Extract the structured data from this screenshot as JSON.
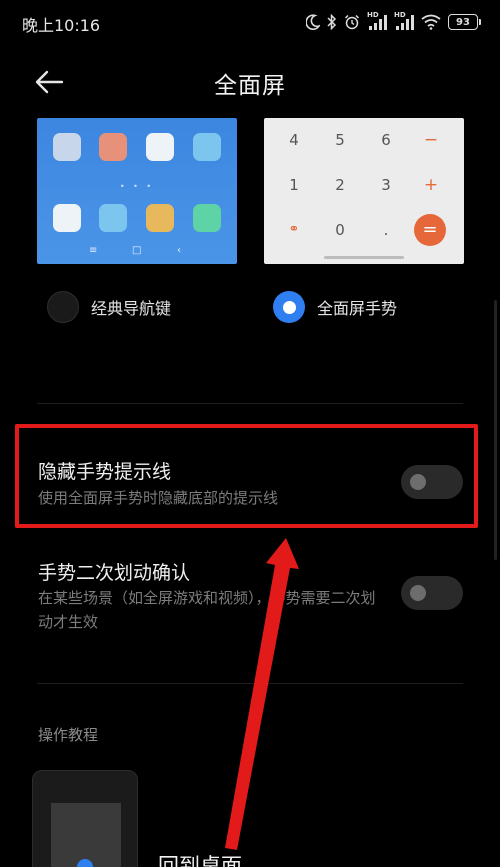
{
  "status_bar": {
    "time": "晚上10:16",
    "network_tag_1": "HD",
    "network_tag_2": "HD",
    "battery": "93",
    "icons": [
      "moon-icon",
      "bluetooth-icon",
      "alarm-icon",
      "signal-icon",
      "signal-icon",
      "wifi-icon",
      "battery-icon"
    ]
  },
  "header": {
    "title": "全面屏",
    "back_icon": "arrow-left-icon"
  },
  "preview_classic": {
    "app_colors": [
      "#c7d6ea",
      "#e8917a",
      "#eef3f8",
      "#7cc5ef",
      "#eef3f8",
      "#7cc5ef",
      "#e8b95c",
      "#5ed3a5"
    ],
    "page_dots": "• • •",
    "nav_keys": [
      "≡",
      "□",
      "‹"
    ]
  },
  "preview_gesture": {
    "keys": [
      "4",
      "5",
      "6",
      "−",
      "1",
      "2",
      "3",
      "+",
      "⚭",
      "0",
      ".",
      "="
    ]
  },
  "nav_options": {
    "classic_label": "经典导航键",
    "gesture_label": "全面屏手势",
    "selected": "gesture"
  },
  "settings": [
    {
      "title": "隐藏手势提示线",
      "subtitle": "使用全面屏手势时隐藏底部的提示线",
      "enabled": false
    },
    {
      "title": "手势二次划动确认",
      "subtitle": "在某些场景（如全屏游戏和视频），手势需要二次划动才生效",
      "enabled": false
    }
  ],
  "tutorial": {
    "section_label": "操作教程",
    "item_title": "回到桌面"
  },
  "colors": {
    "accent": "#2f7ff0",
    "highlight": "#e21a1a",
    "calc_orange": "#e5673a"
  }
}
